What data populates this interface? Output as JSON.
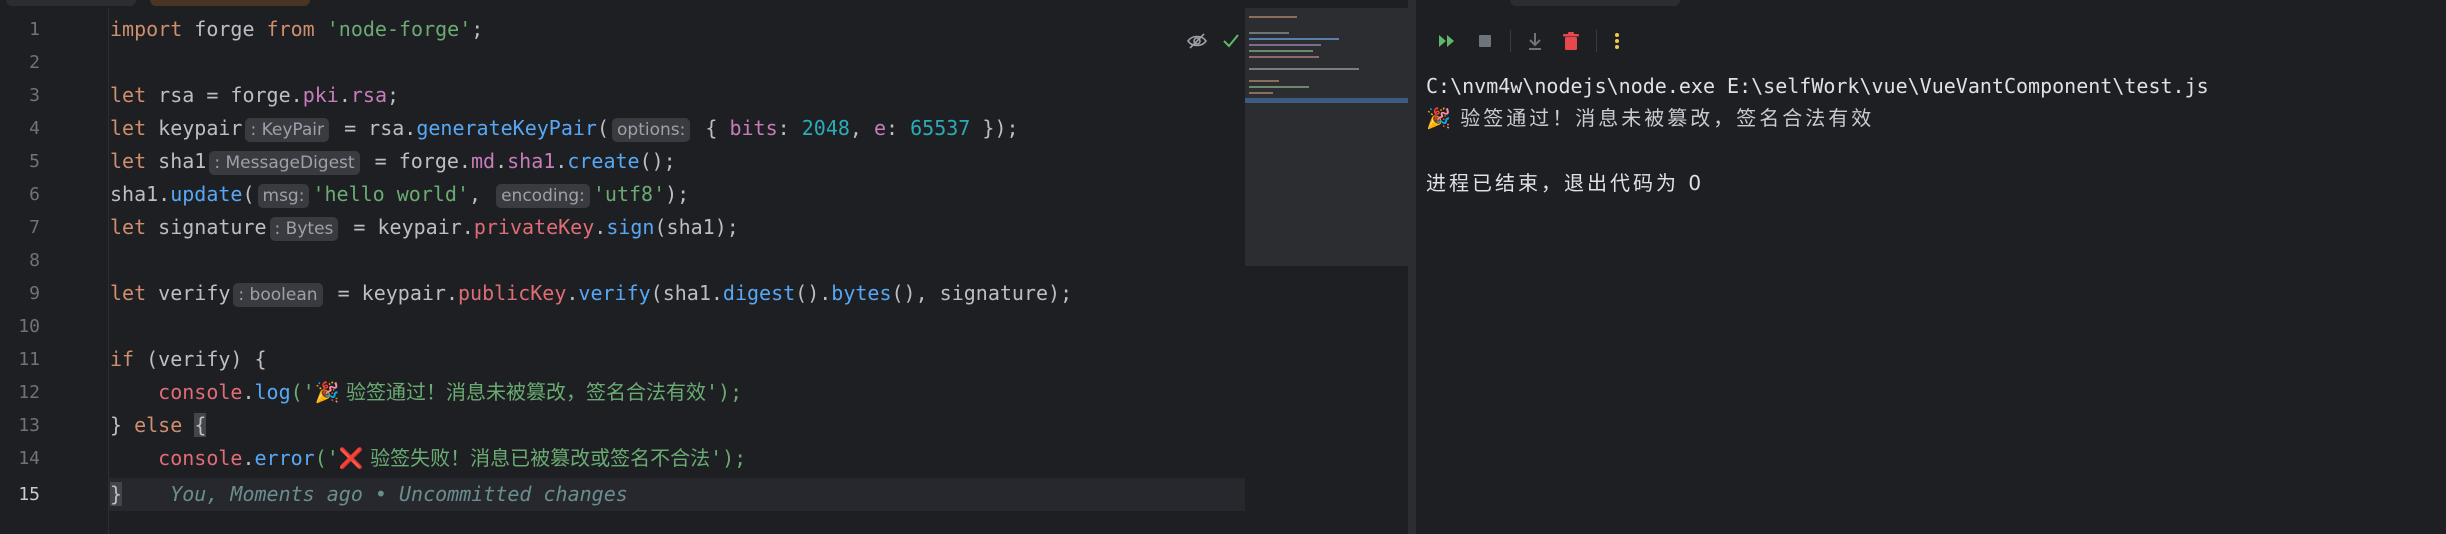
{
  "editor": {
    "line_numbers": [
      "1",
      "2",
      "3",
      "4",
      "5",
      "6",
      "7",
      "8",
      "9",
      "10",
      "11",
      "12",
      "13",
      "14",
      "15"
    ],
    "current_line": "15",
    "lines": {
      "l1": {
        "import_kw": "import",
        "ident": " forge ",
        "from_kw": "from",
        "space": " ",
        "module": "'node-forge'",
        "tail": ";"
      },
      "l3": {
        "let": "let",
        "rest": " rsa = ",
        "forge": "forge",
        "p1": ".",
        "pki": "pki",
        "p2": ".",
        "rsa": "rsa",
        "end": ";"
      },
      "l4": {
        "let": "let",
        "name": " keypair",
        "hint": ": KeyPair",
        "eq": " = rsa.",
        "fn": "generateKeyPair",
        "open": "(",
        "opt_hint": "options:",
        "obj_open": " { ",
        "bits": "bits",
        "colon1": ": ",
        "bits_val": "2048",
        "comma": ", ",
        "e": "e",
        "colon2": ": ",
        "e_val": "65537",
        "close": " });"
      },
      "l5": {
        "let": "let",
        "name": " sha1",
        "hint": ": MessageDigest",
        "eq": " = ",
        "forge": "forge",
        "p1": ".",
        "md": "md",
        "p2": ".",
        "sha1": "sha1",
        "p3": ".",
        "create": "create",
        "end": "();"
      },
      "l6": {
        "obj": "sha1.",
        "fn": "update",
        "open": "(",
        "msg_hint": "msg:",
        "msg": "'hello world'",
        "comma": ", ",
        "enc_hint": "encoding:",
        "enc": "'utf8'",
        "end": ");"
      },
      "l7": {
        "let": "let",
        "name": " signature",
        "hint": ": Bytes",
        "eq": " = keypair.",
        "pk": "privateKey",
        "dot": ".",
        "fn": "sign",
        "end": "(sha1);"
      },
      "l9": {
        "let": "let",
        "name": " verify",
        "hint": ": boolean",
        "eq": " = keypair.",
        "pk": "publicKey",
        "dot": ".",
        "fn": "verify",
        "a": "(sha1.",
        "digest": "digest",
        "b": "().",
        "bytes": "bytes",
        "end": "(), signature);"
      },
      "l11": {
        "if": "if",
        "rest": " (verify) {"
      },
      "l12": {
        "indent": "    ",
        "console": "console",
        "dot": ".",
        "fn": "log",
        "open": "('",
        "emoji": "🎉",
        "msg": " 验签通过！消息未被篡改，签名合法有效",
        "close": "');"
      },
      "l13": {
        "close": "} ",
        "else": "else",
        "space": " ",
        "brace": "{"
      },
      "l14": {
        "indent": "    ",
        "console": "console",
        "dot": ".",
        "fn": "error",
        "open": "('",
        "emoji": "❌",
        "msg": " 验签失败！消息已被篡改或签名不合法",
        "close": "');"
      },
      "l15": {
        "brace": "}",
        "blame": "    You, Moments ago • Uncommitted changes"
      }
    }
  },
  "run_panel": {
    "toolbar": [
      "rerun-icon",
      "stop-icon",
      "scroll-to-end-icon",
      "clear-icon",
      "more-icon"
    ],
    "output": {
      "cmd": "C:\\nvm4w\\nodejs\\node.exe E:\\selfWork\\vue\\VueVantComponent\\test.js",
      "emoji": "🎉",
      "success": " 验签通过！消息未被篡改，签名合法有效",
      "exit": "进程已结束，退出代码为 0"
    }
  },
  "colors": {
    "keyword": "#cf8e6d",
    "function": "#56a8f5",
    "string": "#6aab73",
    "number": "#2aacb8",
    "property": "#c77dbb",
    "console": "#e06c75",
    "background": "#1e1f22"
  }
}
